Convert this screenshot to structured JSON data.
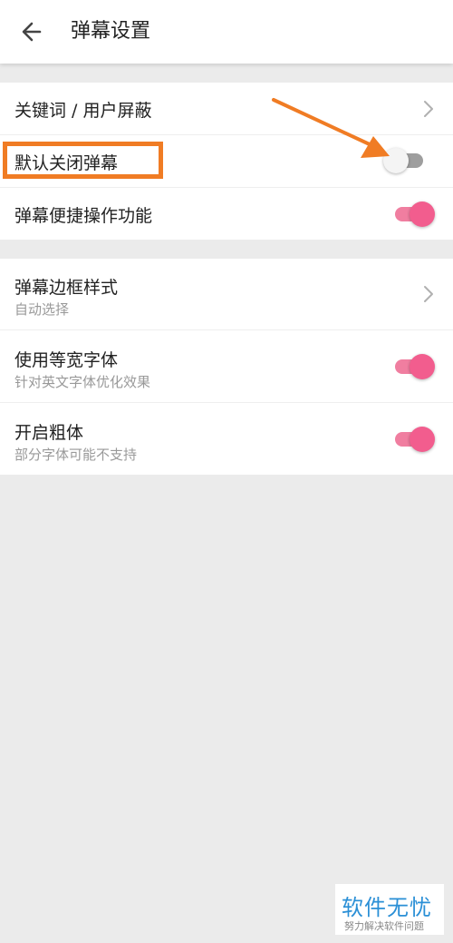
{
  "header": {
    "title": "弹幕设置",
    "back_icon": "arrow-left-icon"
  },
  "section1": {
    "rows": [
      {
        "label": "关键词 / 用户屏蔽",
        "control": "chevron"
      },
      {
        "label": "默认关闭弹幕",
        "control": "toggle",
        "toggle_on": false
      },
      {
        "label": "弹幕便捷操作功能",
        "control": "toggle",
        "toggle_on": true
      }
    ]
  },
  "section2": {
    "rows": [
      {
        "label": "弹幕边框样式",
        "sublabel": "自动选择",
        "control": "chevron"
      },
      {
        "label": "使用等宽字体",
        "sublabel": "针对英文字体优化效果",
        "control": "toggle",
        "toggle_on": true
      },
      {
        "label": "开启粗体",
        "sublabel": "部分字体可能不支持",
        "control": "toggle",
        "toggle_on": true
      }
    ]
  },
  "annotation": {
    "box_color": "#f07c24",
    "arrow_color": "#f07c24"
  },
  "colors": {
    "toggle_on": "#f25d8e",
    "toggle_off": "#9e9e9e",
    "background": "#ebebeb"
  },
  "watermark": {
    "main": "软件无忧",
    "sub": "努力解决软件问题"
  }
}
